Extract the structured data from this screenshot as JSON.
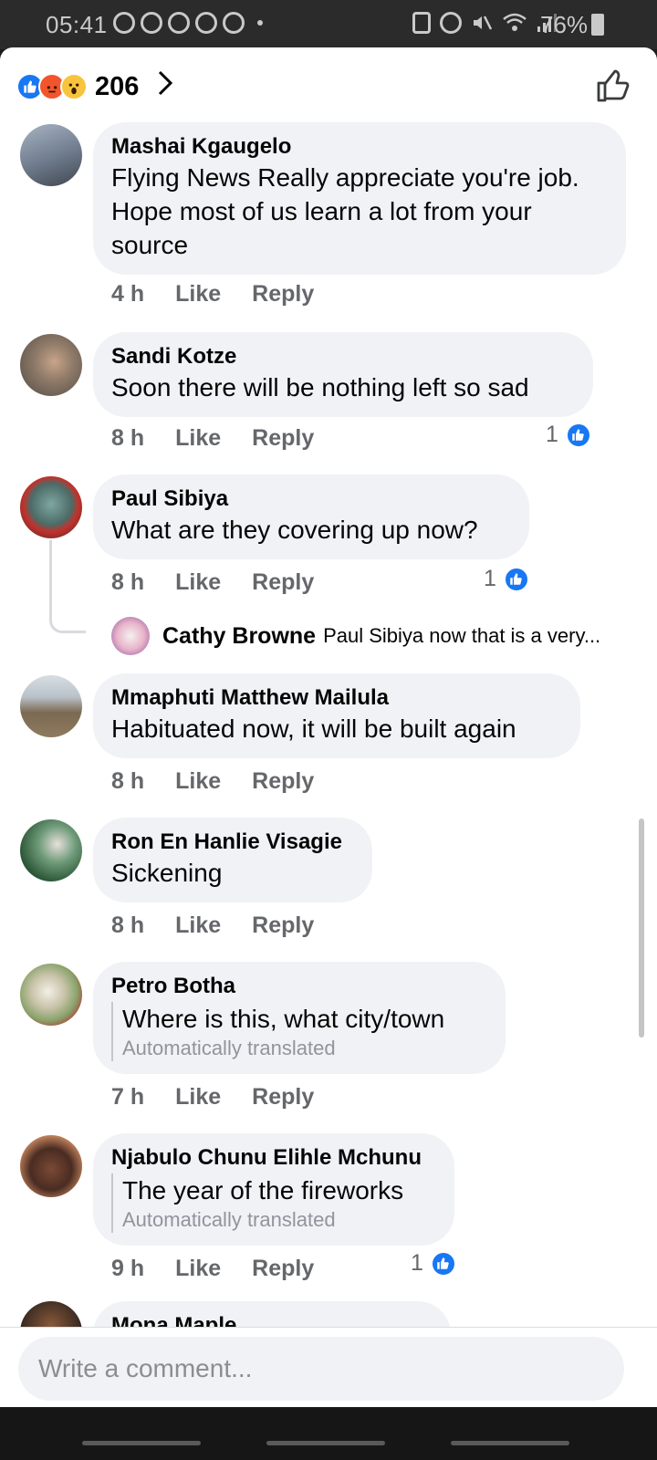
{
  "status_bar": {
    "time": "05:41",
    "battery": "76%",
    "icons_left": [
      "whatsapp-icon",
      "messenger-icon",
      "messenger-icon",
      "messenger-icon",
      "sync-icon"
    ],
    "icons_right": [
      "lock-icon",
      "alarm-icon",
      "mute-icon",
      "wifi-icon",
      "signal-icon",
      "battery-icon"
    ]
  },
  "header": {
    "reaction_count": "206",
    "reactions": [
      "like",
      "angry",
      "wow"
    ]
  },
  "comments": [
    {
      "author": "Mashai Kgaugelo",
      "lines": [
        "Flying News Really appreciate you're job.",
        "Hope most of us learn a lot from your",
        "source"
      ],
      "time": "4 h",
      "like": "Like",
      "reply": "Reply"
    },
    {
      "author": "Sandi Kotze",
      "lines": [
        "Soon there will be nothing left so sad"
      ],
      "time": "8 h",
      "like": "Like",
      "reply": "Reply",
      "likes": "1"
    },
    {
      "author": "Paul Sibiya",
      "lines": [
        "What are they covering up now?"
      ],
      "time": "8 h",
      "like": "Like",
      "reply": "Reply",
      "likes": "1",
      "reply_preview": {
        "author": "Cathy Browne",
        "text": "Paul Sibiya now that is a very..."
      }
    },
    {
      "author": "Mmaphuti Matthew Mailula",
      "lines": [
        "Habituated now, it will be built again"
      ],
      "time": "8 h",
      "like": "Like",
      "reply": "Reply"
    },
    {
      "author": "Ron En Hanlie Visagie",
      "lines": [
        "Sickening"
      ],
      "time": "8 h",
      "like": "Like",
      "reply": "Reply"
    },
    {
      "author": "Petro Botha",
      "lines": [
        "Where is this, what city/town"
      ],
      "translated": "Automatically translated",
      "time": "7 h",
      "like": "Like",
      "reply": "Reply"
    },
    {
      "author": "Njabulo Chunu Elihle Mchunu",
      "lines": [
        "The year of the fireworks"
      ],
      "translated": "Automatically translated",
      "time": "9 h",
      "like": "Like",
      "reply": "Reply",
      "likes": "1"
    },
    {
      "author": "Mona Maple"
    }
  ],
  "composer": {
    "placeholder": "Write a comment..."
  },
  "colors": {
    "accent": "#1877f2",
    "bubble": "#f0f2f5",
    "muted_text": "#65676b"
  }
}
